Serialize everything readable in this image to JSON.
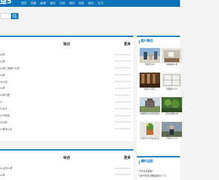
{
  "header": {
    "logo_text": "益5",
    "nav": [
      "首页",
      "科普",
      "新闻",
      "娱乐",
      "百科",
      "知识",
      "综合",
      "热点",
      "生活"
    ]
  },
  "search": {
    "placeholder": ""
  },
  "knowledge": {
    "title": "知识",
    "more": "更多",
    "items": [
      {
        "title": "么样",
        "date": "2023-08-30 08:32"
      },
      {
        "title": "么样",
        "date": "2023-08-30 08:32"
      },
      {
        "title": "么样工资能行么样",
        "date": "2023-08-30 08:31"
      },
      {
        "title": "么样",
        "date": "2023-08-30 08:31"
      },
      {
        "title": "什么样",
        "date": "2023-08-30 08:31"
      },
      {
        "title": "么样",
        "date": "2023-08-30 08:31"
      },
      {
        "title": "么样代表",
        "date": "2023-08-30 08:31"
      },
      {
        "title": "么",
        "date": "2023-08-30 08:31"
      },
      {
        "title": "么水平",
        "date": "2023-08-30 08:31"
      },
      {
        "title": "么不变色",
        "date": "2023-08-30 08:31"
      },
      {
        "title": "什么样",
        "date": "2023-08-30 08:31"
      },
      {
        "title": "么事怎么办",
        "date": "2023-08-30 08:31"
      }
    ]
  },
  "comprehensive": {
    "title": "综合",
    "more": "更多",
    "items": [
      {
        "title": "么合怎么样",
        "date": "2023-08-30 08:32"
      },
      {
        "title": "么样",
        "date": "2023-08-30 08:32"
      }
    ]
  },
  "sidebar": {
    "pictures_title": "图片精选",
    "pictures": [
      {
        "caption": "阿修范么样"
      },
      {
        "caption": "木地板样么样"
      },
      {
        "caption": "新南信息网元"
      },
      {
        "caption": "平面图尺寸么"
      },
      {
        "caption": "树樱鼎名木树形状特征"
      },
      {
        "caption": "多年生植物么样"
      },
      {
        "caption": "家里养什么花好运又旺"
      },
      {
        "caption": "夸张女人么么"
      }
    ],
    "hot_title": "爆料追踪",
    "hot_items": [
      "大学女孩留级么",
      "0家子类来当聊能接收几个人"
    ]
  },
  "colors": {
    "accent": "#1a7fc5",
    "topbar": "#0a72b9",
    "background": "#f4f4f4"
  }
}
